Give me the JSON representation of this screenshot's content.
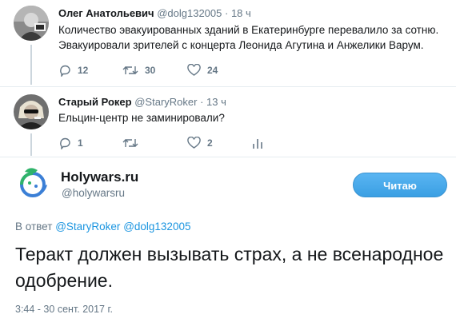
{
  "tweet1": {
    "name": "Олег Анатольевич",
    "handle": "@dolg132005",
    "dot": "·",
    "time": "18 ч",
    "text": "Количество эвакуированных зданий в Екатеринбурге перевалило за сотню. Эвакуировали зрителей с концерта Леонида Агутина и Анжелики Варум.",
    "replies": "12",
    "retweets": "30",
    "likes": "24"
  },
  "tweet2": {
    "name": "Старый Рокер",
    "handle": "@StaryRoker",
    "dot": "·",
    "time": "13 ч",
    "text": "Ельцин-центр не заминировали?",
    "replies": "1",
    "retweets": "",
    "likes": "2"
  },
  "main": {
    "name": "Holywars.ru",
    "handle": "@holywarsru",
    "follow_label": "Читаю",
    "reply_prefix": "В ответ",
    "reply_user1": "@StaryRoker",
    "reply_user2": "@dolg132005",
    "text": "Теракт должен вызывать страх, а не всенародное одобрение.",
    "timestamp": "3:44 - 30 сент. 2017 г."
  },
  "colors": {
    "accent": "#1da1f2",
    "link": "#1b95e0",
    "muted": "#657786"
  }
}
